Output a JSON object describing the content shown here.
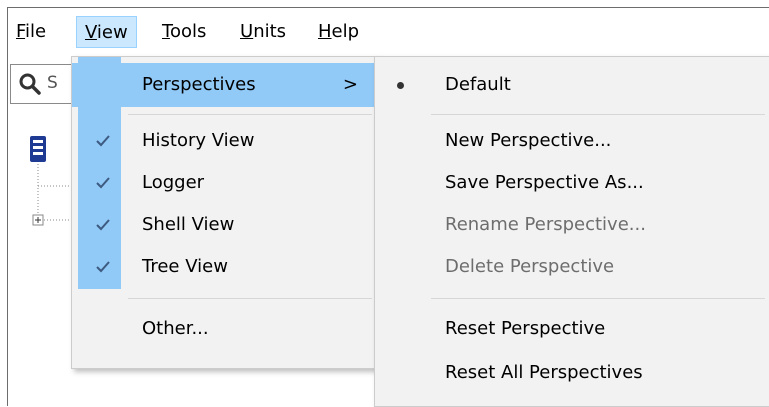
{
  "menubar": {
    "items": [
      {
        "label": "File",
        "mnemonic": "F",
        "rest": "ile"
      },
      {
        "label": "View",
        "mnemonic": "V",
        "rest": "iew"
      },
      {
        "label": "Tools",
        "mnemonic": "T",
        "rest": "ools"
      },
      {
        "label": "Units",
        "mnemonic": "U",
        "rest": "nits"
      },
      {
        "label": "Help",
        "mnemonic": "H",
        "rest": "elp"
      }
    ]
  },
  "search": {
    "placeholder": "S"
  },
  "view_menu": {
    "perspectives_label": "Perspectives",
    "perspectives_arrow": ">",
    "history_view": "History View",
    "logger": "Logger",
    "shell_view": "Shell View",
    "tree_view": "Tree View",
    "other": "Other..."
  },
  "perspectives_menu": {
    "default": "Default",
    "new": "New Perspective...",
    "save_as": "Save Perspective As...",
    "rename": "Rename Perspective...",
    "delete": "Delete Perspective",
    "reset": "Reset Perspective",
    "reset_all": "Reset All Perspectives"
  },
  "colors": {
    "highlight": "#91c9f7",
    "menubar_active": "#cce8ff",
    "menu_bg": "#f2f2f2",
    "disabled_text": "#6d6d6d",
    "tree_icon": "#1f3a93"
  }
}
